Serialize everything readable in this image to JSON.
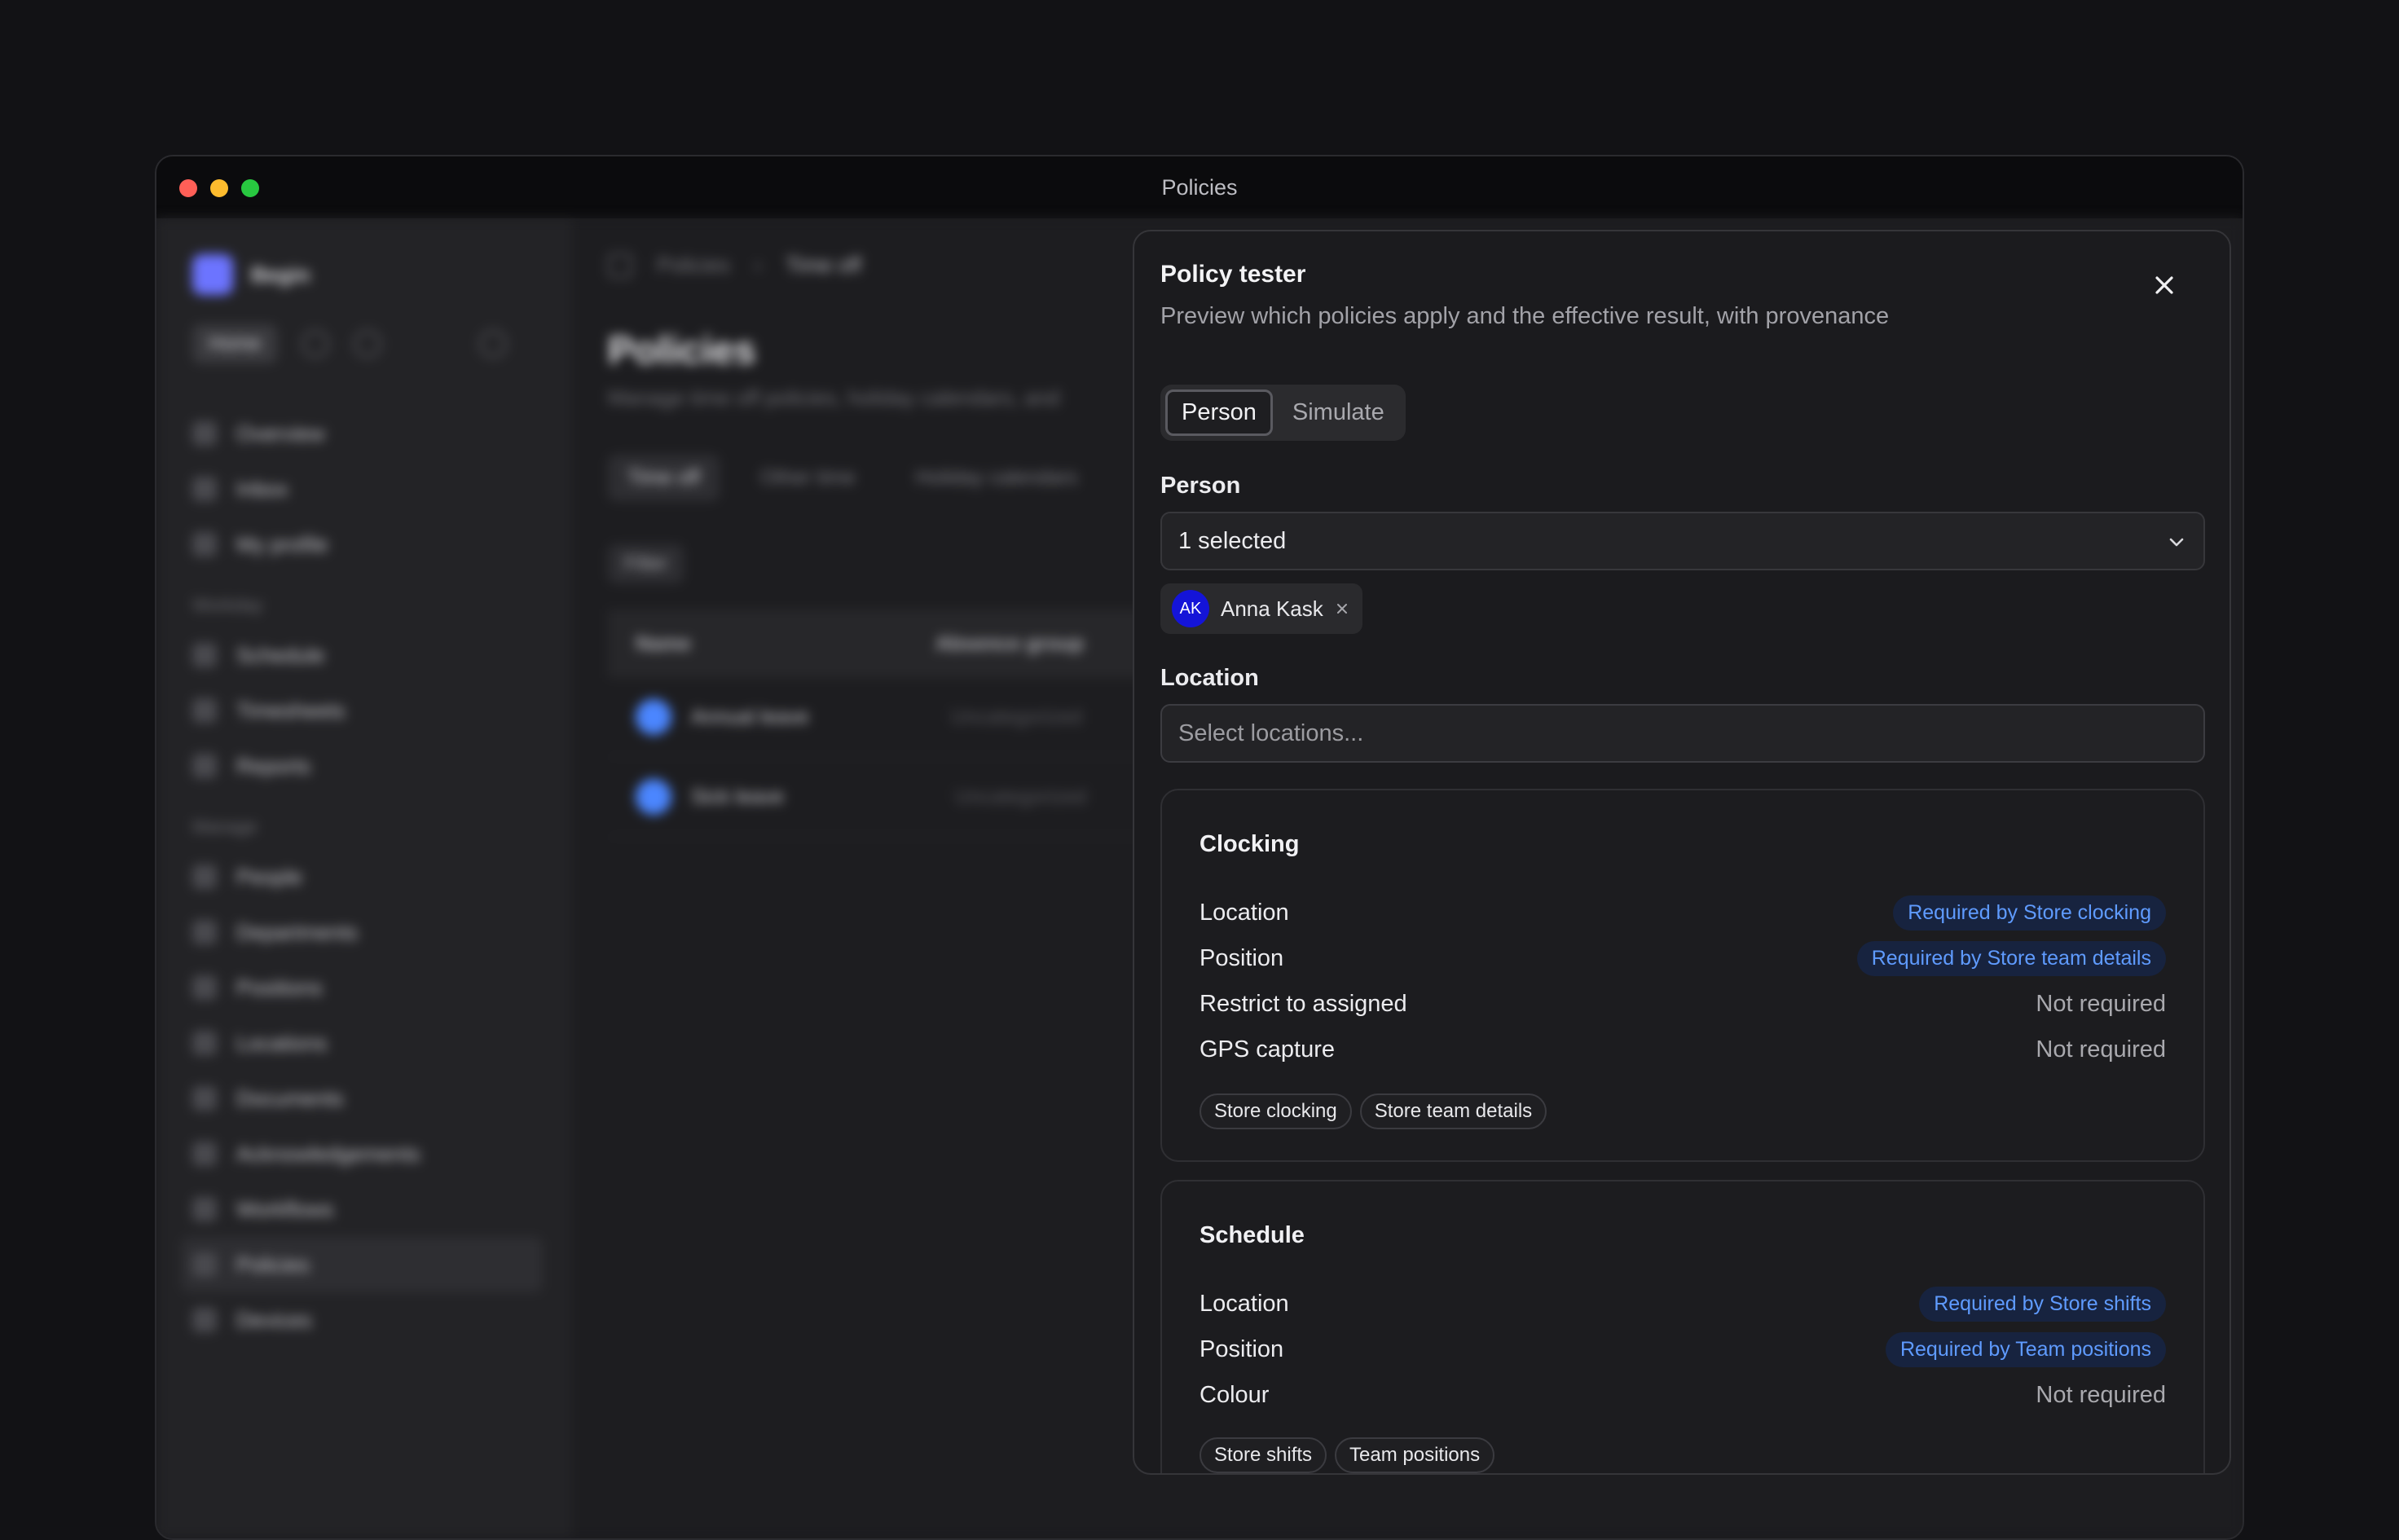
{
  "window": {
    "title": "Policies"
  },
  "background": {
    "workspace": "Begin",
    "home_label": "Home",
    "nav": [
      {
        "label": "Overview"
      },
      {
        "label": "Inbox"
      },
      {
        "label": "My profile"
      }
    ],
    "section_workday": "Workday",
    "nav_workday": [
      {
        "label": "Schedule"
      },
      {
        "label": "Timesheets"
      },
      {
        "label": "Reports"
      }
    ],
    "section_manage": "Manage",
    "nav_manage": [
      {
        "label": "People"
      },
      {
        "label": "Departments"
      },
      {
        "label": "Positions"
      },
      {
        "label": "Locations"
      },
      {
        "label": "Documents"
      },
      {
        "label": "Acknowledgements"
      },
      {
        "label": "Workflows"
      },
      {
        "label": "Policies"
      },
      {
        "label": "Devices"
      }
    ],
    "breadcrumb": [
      "Policies",
      "Time off"
    ],
    "page_title": "Policies",
    "page_subtitle": "Manage time off policies, holiday calendars, and",
    "tabs": [
      "Time off",
      "Other time",
      "Holiday calendars"
    ],
    "filter_label": "Filter",
    "table": {
      "headers": [
        "Name",
        "Absence group"
      ],
      "rows": [
        {
          "name": "Annual leave",
          "group": "Uncategorized"
        },
        {
          "name": "Sick leave",
          "group": "Uncategorized"
        }
      ]
    }
  },
  "dialog": {
    "title": "Policy tester",
    "description": "Preview which policies apply and the effective result, with provenance",
    "modes": [
      "Person",
      "Simulate"
    ],
    "active_mode": "Person",
    "person_label": "Person",
    "person_select_value": "1 selected",
    "selected_person": {
      "initials": "AK",
      "name": "Anna Kask"
    },
    "location_label": "Location",
    "location_placeholder": "Select locations...",
    "sections": [
      {
        "title": "Clocking",
        "rows": [
          {
            "label": "Location",
            "value": "Required by Store clocking",
            "required": true
          },
          {
            "label": "Position",
            "value": "Required by Store team details",
            "required": true
          },
          {
            "label": "Restrict to assigned",
            "value": "Not required",
            "required": false
          },
          {
            "label": "GPS capture",
            "value": "Not required",
            "required": false
          }
        ],
        "tags": [
          "Store clocking",
          "Store team details"
        ]
      },
      {
        "title": "Schedule",
        "rows": [
          {
            "label": "Location",
            "value": "Required by Store shifts",
            "required": true
          },
          {
            "label": "Position",
            "value": "Required by Team positions",
            "required": true
          },
          {
            "label": "Colour",
            "value": "Not required",
            "required": false
          }
        ],
        "tags": [
          "Store shifts",
          "Team positions"
        ]
      }
    ]
  },
  "colors": {
    "accent_blue": "#5f9bff",
    "avatar_bg": "#1414d8"
  }
}
